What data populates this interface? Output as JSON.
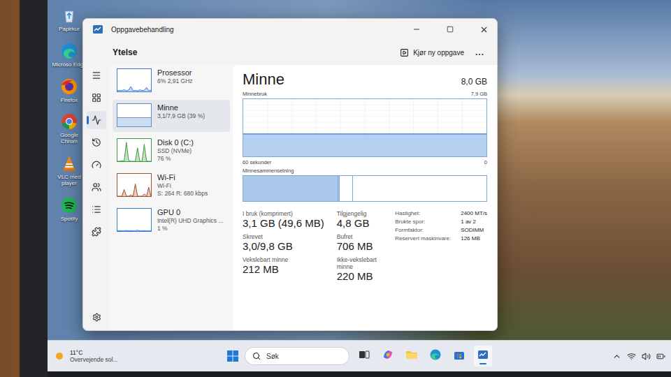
{
  "desktop": {
    "icons": [
      {
        "label": "Papirkur",
        "kind": "recycle"
      },
      {
        "label": "Microso Edge",
        "kind": "edge"
      },
      {
        "label": "Firefox",
        "kind": "firefox"
      },
      {
        "label": "Google Chrom",
        "kind": "chrome"
      },
      {
        "label": "VLC med player",
        "kind": "vlc"
      },
      {
        "label": "Spotify",
        "kind": "spotify"
      }
    ]
  },
  "window": {
    "title": "Oppgavebehandling",
    "section": "Ytelse",
    "run_task": "Kjør ny oppgave",
    "more": "...",
    "rail": [
      {
        "selected": false
      },
      {
        "selected": false
      },
      {
        "selected": true
      },
      {
        "selected": false
      },
      {
        "selected": false
      },
      {
        "selected": false
      },
      {
        "selected": false
      },
      {
        "selected": false
      }
    ],
    "perf_items": [
      {
        "name": "Prosessor",
        "lines": [
          "6% 2,91 GHz"
        ],
        "selected": false,
        "color": "#3a7bd5",
        "values": [
          3,
          5,
          4,
          8,
          3,
          6,
          22,
          4,
          5,
          3,
          7,
          4,
          5,
          18,
          4,
          6
        ]
      },
      {
        "name": "Minne",
        "lines": [
          "3,1/7,9 GB (39 %)"
        ],
        "selected": true,
        "color": "#5b8fd0",
        "values": [
          39,
          39,
          39,
          39,
          39,
          39,
          39,
          39,
          39,
          39,
          39,
          39,
          39,
          39,
          39,
          39
        ]
      },
      {
        "name": "Disk 0 (C:)",
        "lines": [
          "SSD (NVMe)",
          "76 %"
        ],
        "selected": false,
        "color": "#3f9a3f",
        "values": [
          0,
          0,
          2,
          0,
          85,
          4,
          0,
          0,
          0,
          60,
          0,
          0,
          76,
          2,
          0,
          0
        ]
      },
      {
        "name": "Wi-Fi",
        "lines": [
          "Wi-Fi",
          "S: 264 R: 680 kbps"
        ],
        "selected": false,
        "color": "#a0522d",
        "values": [
          0,
          0,
          0,
          30,
          0,
          0,
          5,
          0,
          55,
          0,
          0,
          0,
          10,
          0,
          40,
          0
        ]
      },
      {
        "name": "GPU 0",
        "lines": [
          "Intel(R) UHD Graphics ...",
          "1 %"
        ],
        "selected": false,
        "color": "#3a7bd5",
        "values": [
          1,
          2,
          1,
          1,
          3,
          1,
          2,
          1,
          1,
          4,
          1,
          1,
          2,
          1,
          1,
          1
        ]
      }
    ],
    "main": {
      "heading": "Minne",
      "total": "8,0 GB",
      "chart": {
        "label": "Minnebruk",
        "max": "7,9 GB",
        "x_start": "60 sekunder",
        "x_end": "0",
        "max_value": 7.9,
        "values": [
          3.1,
          3.1,
          3.1,
          3.1,
          3.1,
          3.1,
          3.1,
          3.1,
          3.1,
          3.1,
          3.1,
          3.1,
          3.1,
          3.1,
          3.1,
          3.1,
          3.1,
          3.1,
          3.1,
          3.1
        ]
      },
      "composition": {
        "label": "Minnesammensetning",
        "segments": [
          {
            "level": 0.39,
            "filled": true
          },
          {
            "level": 0.006,
            "filled": true
          },
          {
            "level": 0.055,
            "filled": false
          },
          {
            "level": 0.549,
            "filled": false
          }
        ]
      },
      "stats": [
        {
          "label": "I bruk (komprimert)",
          "value": "3,1 GB (49,6 MB)"
        },
        {
          "label": "Tilgjengelig",
          "value": "4,8 GB"
        },
        {
          "label": "Skrevet",
          "value": "3,0/9,8 GB"
        },
        {
          "label": "Bufret",
          "value": "706 MB"
        },
        {
          "label": "Vekslebart minne",
          "value": "212 MB"
        },
        {
          "label": "Ikke-vekslebart minne",
          "value": "220 MB"
        }
      ],
      "specs": [
        {
          "label": "Hastighet:",
          "value": "2400 MT/s"
        },
        {
          "label": "Brukte spor:",
          "value": "1 av 2"
        },
        {
          "label": "Formfaktor:",
          "value": "SODIMM"
        },
        {
          "label": "Reservert maskinvare:",
          "value": "126 MB"
        }
      ]
    }
  },
  "taskbar": {
    "weather": {
      "temp": "11°C",
      "text": "Overvejende sol..."
    },
    "search": {
      "placeholder": "Søk"
    },
    "apps": [
      {
        "kind": "taskview",
        "running": false
      },
      {
        "kind": "copilot",
        "running": false
      },
      {
        "kind": "explorer",
        "running": false
      },
      {
        "kind": "edge",
        "running": false
      },
      {
        "kind": "store",
        "running": false
      },
      {
        "kind": "taskmanager",
        "running": true
      }
    ]
  }
}
